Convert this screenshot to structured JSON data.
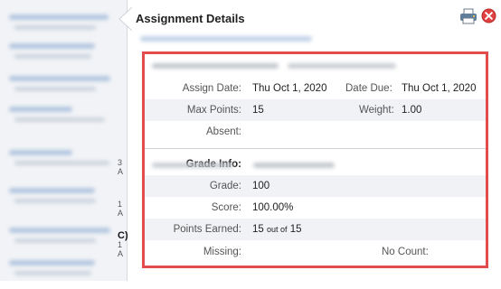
{
  "header": {
    "title": "Assignment Details"
  },
  "icons": {
    "print": "printer-icon",
    "close": "close-icon"
  },
  "sidebar": {
    "tails": [
      "3 A",
      "1 A",
      "C)",
      "1 A"
    ]
  },
  "details": {
    "assign_date_label": "Assign Date:",
    "assign_date_value": "Thu Oct 1, 2020",
    "date_due_label": "Date Due:",
    "date_due_value": "Thu Oct 1, 2020",
    "max_points_label": "Max Points:",
    "max_points_value": "15",
    "weight_label": "Weight:",
    "weight_value": "1.00",
    "absent_label": "Absent:",
    "grade_info_label": "Grade Info:",
    "grade_label": "Grade:",
    "grade_value": "100",
    "score_label": "Score:",
    "score_value": "100.00%",
    "points_earned_label": "Points Earned:",
    "points_earned_value": "15",
    "points_out_of": "out of",
    "points_total": "15",
    "missing_label": "Missing:",
    "no_count_label": "No Count:"
  },
  "colors": {
    "highlight_border": "#e34c4c",
    "close_icon": "#e04040"
  }
}
